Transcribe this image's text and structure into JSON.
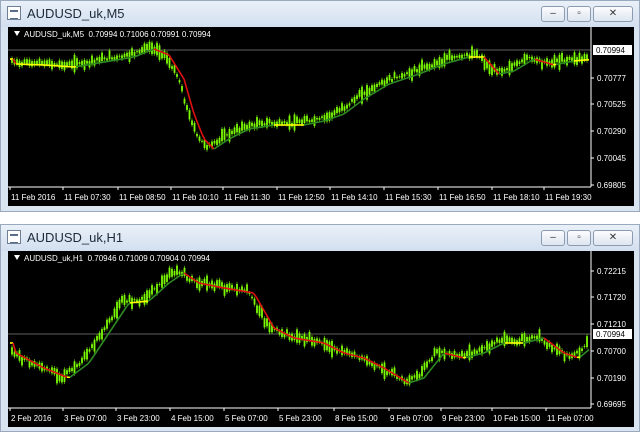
{
  "windows": [
    {
      "title": "AUDUSD_uk,M5",
      "header": {
        "symbol": "AUDUSD_uk,M5",
        "ohlc": "0.70994 0.71006 0.70991 0.70994"
      },
      "current_price": "0.70994",
      "price_labels": [
        "0.70777",
        "0.70525",
        "0.70290",
        "0.70045",
        "0.69805"
      ],
      "time_labels": [
        "11 Feb 2016",
        "11 Feb 07:30",
        "11 Feb 08:50",
        "11 Feb 10:10",
        "11 Feb 11:30",
        "11 Feb 12:50",
        "11 Feb 14:10",
        "11 Feb 15:30",
        "11 Feb 16:50",
        "11 Feb 18:10",
        "11 Feb 19:30"
      ],
      "buttons": {
        "minimize": "–",
        "restore": "▫",
        "close": "✕"
      }
    },
    {
      "title": "AUDUSD_uk,H1",
      "header": {
        "symbol": "AUDUSD_uk,H1",
        "ohlc": "0.70946 0.71009 0.70904 0.70994"
      },
      "current_price": "0.70994",
      "price_labels": [
        "0.72215",
        "0.71720",
        "0.71210",
        "0.70700",
        "0.70190",
        "0.69695"
      ],
      "time_labels": [
        "2 Feb 2016",
        "3 Feb 07:00",
        "3 Feb 23:00",
        "4 Feb 15:00",
        "5 Feb 07:00",
        "5 Feb 23:00",
        "8 Feb 15:00",
        "9 Feb 07:00",
        "9 Feb 23:00",
        "10 Feb 15:00",
        "11 Feb 07:00"
      ],
      "buttons": {
        "minimize": "–",
        "restore": "▫",
        "close": "✕"
      }
    }
  ],
  "colors": {
    "background": "#000000",
    "candle": "#7CFC00",
    "ma_up": "#2E8B22",
    "ma_down": "#E01010",
    "ma_flat": "#FFFF00",
    "price_line": "#C0C0C0"
  },
  "icons": [
    "chart-window-icon",
    "minimize-icon",
    "restore-icon",
    "close-icon",
    "dropdown-triangle-icon"
  ]
}
